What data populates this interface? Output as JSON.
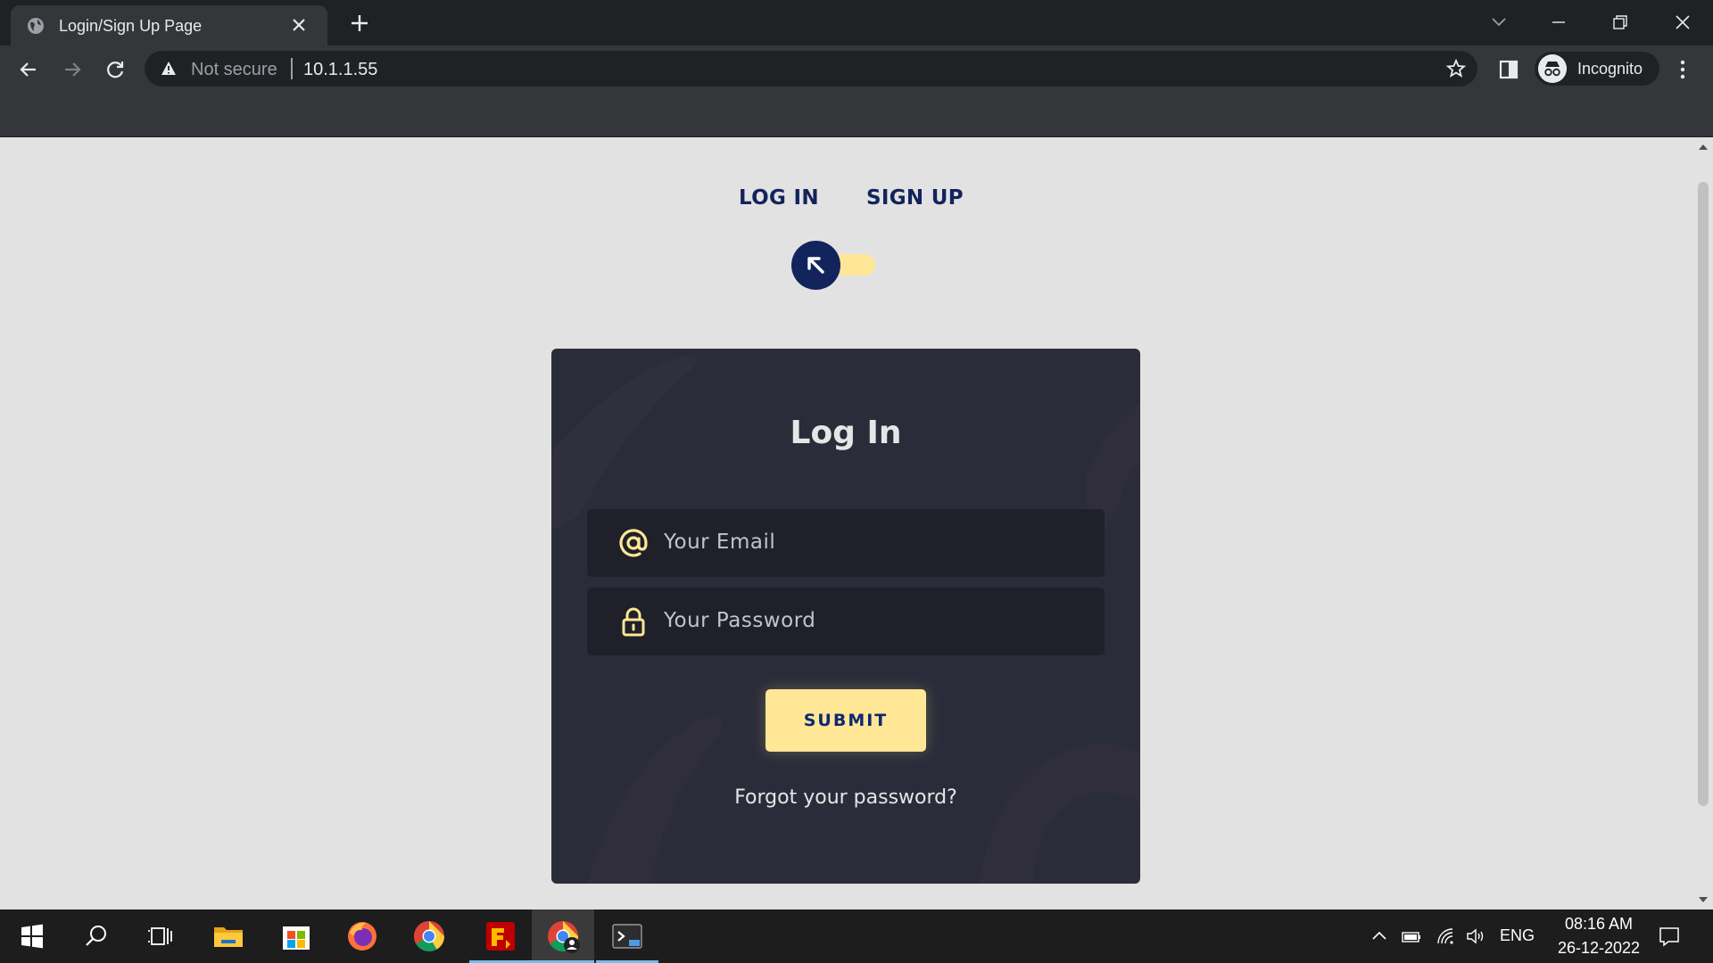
{
  "browser": {
    "tab_title": "Login/Sign Up Page",
    "security_label": "Not secure",
    "url": "10.1.1.55",
    "profile_label": "Incognito"
  },
  "page": {
    "mode_tabs": [
      "LOG IN",
      "SIGN UP"
    ],
    "toggle_state": "login",
    "card": {
      "title": "Log In",
      "email_placeholder": "Your Email",
      "password_placeholder": "Your Password",
      "submit_label": "SUBMIT",
      "forgot_link": "Forgot your password?"
    },
    "colors": {
      "primary_navy": "#13235c",
      "accent_yellow": "#ffe796",
      "card_bg": "#2b2c3a",
      "input_bg": "#1f2029",
      "page_bg": "#e2e2e2"
    }
  },
  "taskbar": {
    "apps": [
      "start-icon",
      "search-icon",
      "task-view-icon",
      "file-explorer-icon",
      "microsoft-store-icon",
      "firefox-icon",
      "chrome-icon",
      "filezilla-icon",
      "chrome-incognito-icon",
      "terminal-preview-icon"
    ],
    "language": "ENG",
    "time": "08:16 AM",
    "date": "26-12-2022"
  }
}
